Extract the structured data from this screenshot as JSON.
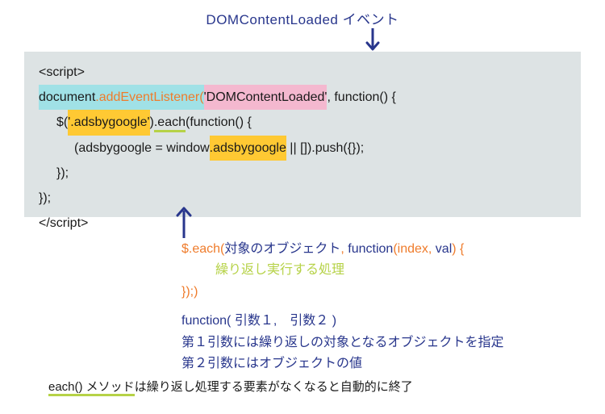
{
  "title": "DOMContentLoaded イベント",
  "code": {
    "l1": "<script>",
    "l2a": "document",
    "l2b": ".addEventListener(",
    "l2c": "'DOMContentLoaded'",
    "l2d": ", function() {",
    "l3a": "$(",
    "l3b": "'.adsbygoogle'",
    "l3c": ")",
    "l3d": ".each",
    "l3e": "(function() {",
    "l4a": "(adsbygoogle = window",
    "l4b": ".adsbygoogle",
    "l4c": " || []).push({});",
    "l5": "});",
    "l6": "});",
    "l7": "</script>"
  },
  "anno": {
    "a1a": "$.each(",
    "a1b": "対象のオブジェクト",
    "a1c": ", ",
    "a1d": "function",
    "a1e": "(index, ",
    "a1f": "val",
    "a1g": ") {",
    "a2": "繰り返し実行する処理",
    "a3": "});)",
    "b1": "function( 引数１,　引数２ )",
    "b2": "第１引数には繰り返しの対象となるオブジェクトを指定",
    "b3": "第２引数にはオブジェクトの値"
  },
  "footnote": {
    "lead": "each() メソッド",
    "rest": "は繰り返し処理する要素がなくなると自動的に終了"
  }
}
